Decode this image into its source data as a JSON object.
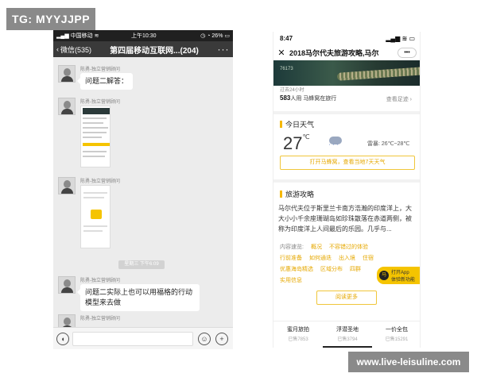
{
  "watermark_top": "TG: MYYJJPP",
  "watermark_bottom": "www.live-leisuline.com",
  "wechat": {
    "status": {
      "carrier": "中国移动",
      "time": "上午10:30",
      "battery": "26%"
    },
    "nav": {
      "back_label": "微信(535)",
      "title": "第四届移动互联网...(204)",
      "more": "···"
    },
    "sender_name": "陈勇-独立营销顾问",
    "messages": [
      {
        "text": "问题二解答："
      },
      {
        "text": ""
      },
      {
        "text": ""
      },
      {
        "text": "问题二实际上也可以用福格的行动模型来去做"
      },
      {
        "text": ""
      }
    ],
    "time_badge": "星期三 下午6:09"
  },
  "mafengwo": {
    "status": {
      "time": "8:47"
    },
    "nav": {
      "close": "✕",
      "title": "2018马尔代夫旅游攻略,马尔"
    },
    "banner": {
      "count": "76173"
    },
    "info": {
      "line1": "过去24小时",
      "count": "583",
      "count_suffix": "人用",
      "app_name": "马蜂窝",
      "verb": "在旅行",
      "see_more": "查看足迹 ›"
    },
    "weather": {
      "section_title": "今日天气",
      "temp": "27",
      "unit": "℃",
      "range_label": "雷暴:",
      "range": "26℃~28℃",
      "button": "打开马蜂窝，查看当地7天天气"
    },
    "guide": {
      "section_title": "旅游攻略",
      "paragraph": "马尔代夫位于斯里兰卡南方浩瀚的印度洋上，大大小小千余座珊瑚岛如珍珠散落在赤道两侧，被称为印度洋上人间最后的乐园。几乎与...",
      "tags_label": "内容速览:",
      "tags_row1": [
        "概况",
        "不容错过的体验"
      ],
      "tags_row2": [
        "行前准备",
        "如何通迭",
        "出入境",
        "住宿"
      ],
      "tags_row3": [
        "优惠海岛精选",
        "区域分布",
        "四群"
      ],
      "tags_row4": [
        "实用信息"
      ],
      "read_more": "阅读更多",
      "app_badge_line1": "打开App",
      "app_badge_line2": "体验新功能",
      "app_badge_icon": "马"
    },
    "tabs": [
      {
        "name": "蜜月旅拍",
        "sub": "已售7853"
      },
      {
        "name": "浮潜圣地",
        "sub": "已售3794"
      },
      {
        "name": "一价全包",
        "sub": "已售15291"
      }
    ]
  }
}
